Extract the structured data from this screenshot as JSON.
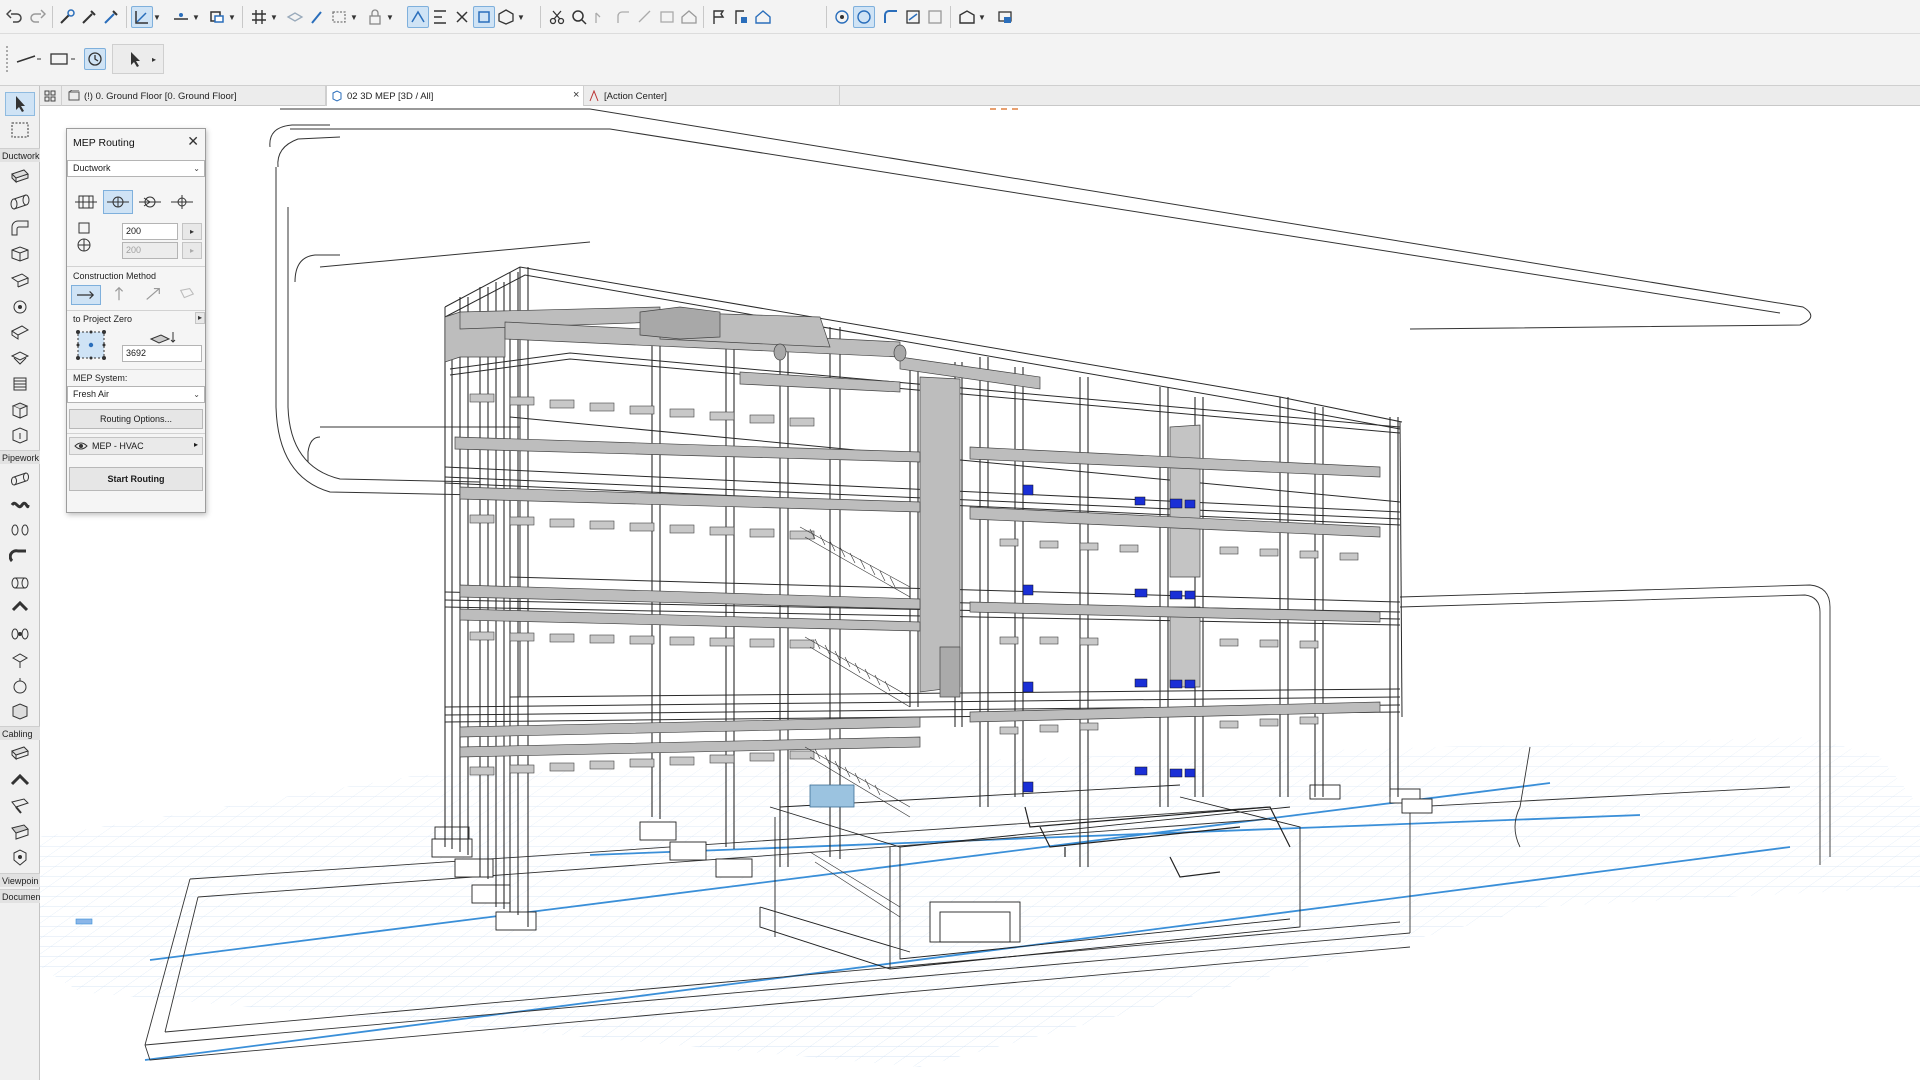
{
  "tabs": [
    {
      "label": "(!) 0. Ground Floor [0. Ground Floor]",
      "active": false
    },
    {
      "label": "02 3D MEP [3D / All]",
      "active": true,
      "close": "×"
    },
    {
      "label": "[Action Center]",
      "active": false
    }
  ],
  "toolbox": {
    "categories": {
      "ductwork": "Ductwork",
      "pipework": "Pipework",
      "cabling": "Cabling",
      "viewpoint": "Viewpoin",
      "document": "Documen"
    }
  },
  "palette": {
    "title": "MEP Routing",
    "close": "✕",
    "domain_select": "Ductwork",
    "width_value": "200",
    "height_value": "200",
    "construction_method_label": "Construction Method",
    "reference_label": "to Project Zero",
    "elevation_value": "3692",
    "mep_system_label": "MEP System:",
    "mep_system_value": "Fresh Air",
    "routing_options_label": "Routing Options...",
    "layer_label": "MEP - HVAC",
    "start_routing_label": "Start Routing"
  },
  "colors": {
    "accent": "#3a8fd8",
    "active_bg": "#cfe3f5",
    "grid": "#c8dcf2",
    "equipment_blue": "#1a2fd6"
  }
}
